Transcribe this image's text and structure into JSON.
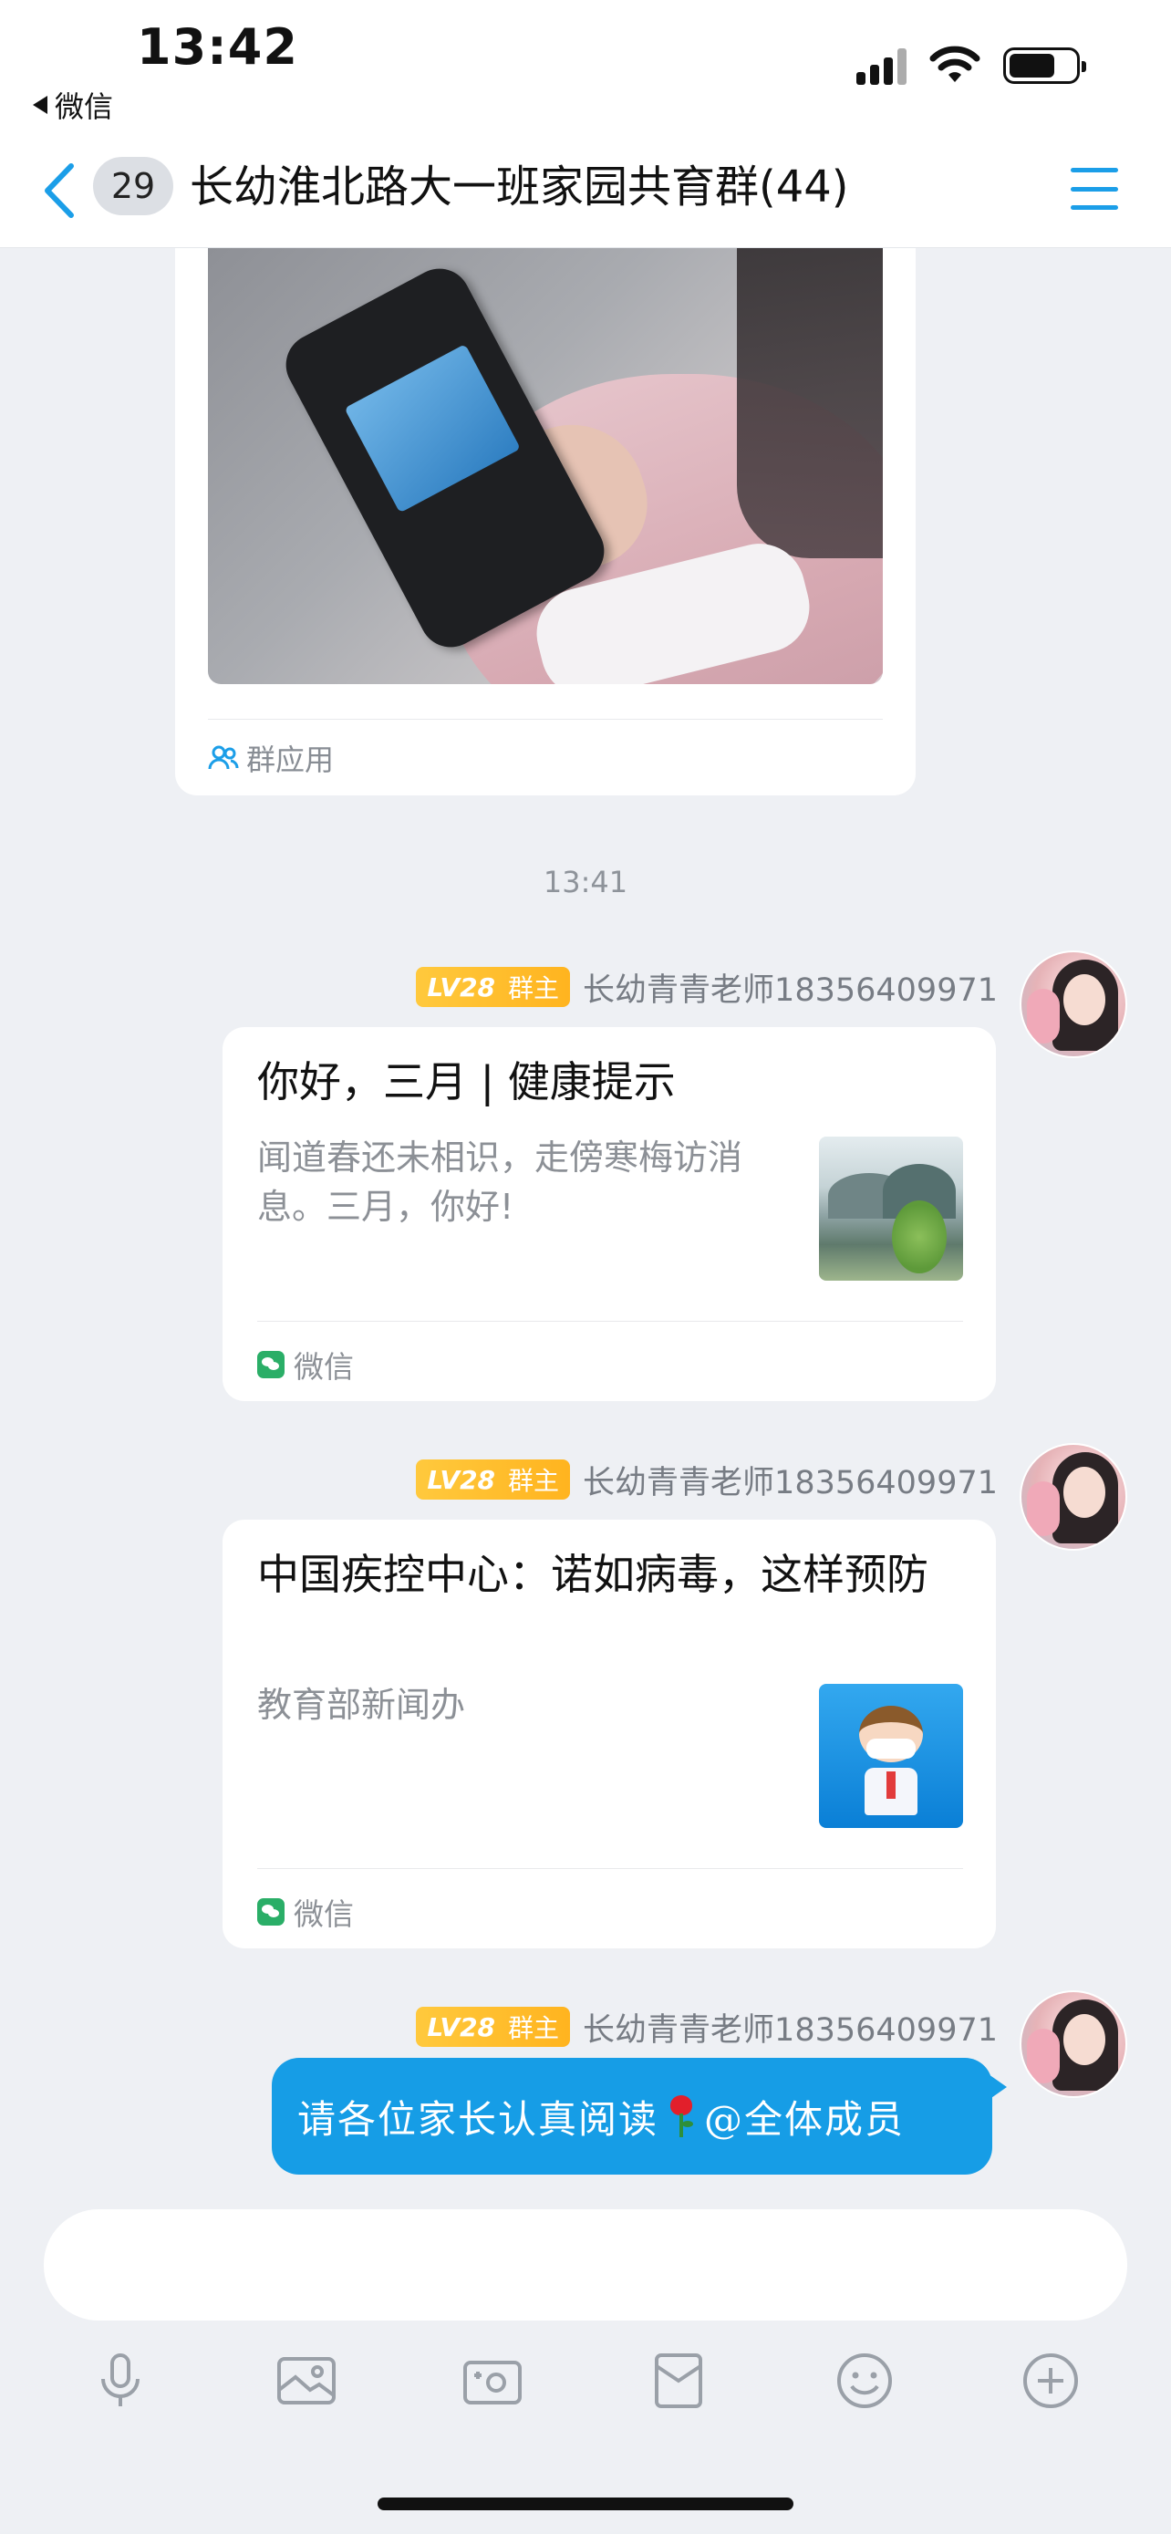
{
  "status_bar": {
    "time": "13:42",
    "back_app": "微信"
  },
  "nav": {
    "unread_count": "29",
    "title": "长幼淮北路大一班家园共育群(44)"
  },
  "image_message": {
    "footer": "群应用"
  },
  "timestamp": "13:41",
  "messages": [
    {
      "level": "LV28",
      "role": "群主",
      "sender": "长幼青青老师18356409971",
      "card": {
        "title": "你好，三月 | 健康提示",
        "description": "闻道春还未相识，走傍寒梅访消息。三月，你好!",
        "source": "微信"
      }
    },
    {
      "level": "LV28",
      "role": "群主",
      "sender": "长幼青青老师18356409971",
      "card": {
        "title": "中国疾控中心：诺如病毒，这样预防",
        "description": "教育部新闻办",
        "source": "微信"
      }
    },
    {
      "level": "LV28",
      "role": "群主",
      "sender": "长幼青青老师18356409971",
      "text_before": "请各位家长认真阅读",
      "text_after": "@全体成员"
    }
  ],
  "colors": {
    "accent": "#169de6",
    "level_badge": "#ffc93d",
    "background": "#eef0f4"
  },
  "toolbar_icons": [
    "microphone-icon",
    "image-icon",
    "camera-icon",
    "red-packet-icon",
    "emoji-icon",
    "plus-icon"
  ]
}
